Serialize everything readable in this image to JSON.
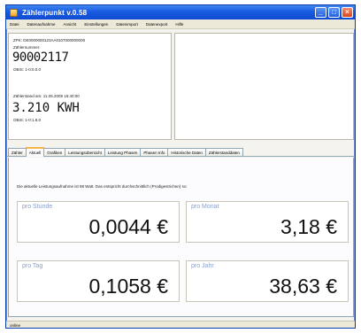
{
  "window": {
    "title": "Zählerpunkt v.0.58",
    "minimize": "_",
    "maximize": "□",
    "close": "×"
  },
  "menu": [
    "Datei",
    "Datenaufnahme",
    "Ansicht",
    "Einstellungen",
    "Datenimport",
    "Datenexport",
    "Hilfe"
  ],
  "meter": {
    "id_line": "ZPK: DE0000000123AA0107000000000",
    "serial_label": "Zählernummer:",
    "serial": "90002117",
    "serial_obis": "OBIS: 1-0:0.0.0",
    "reading_label": "Zählerstand am: 11.05.2009 16:40:00",
    "reading": "3.210 KWH",
    "reading_obis": "OBIS: 1-0:1.8.0"
  },
  "tabs": [
    "Zähler",
    "Aktuell",
    "Grafiken",
    "Leistungsübersicht",
    "Leistung Phasen",
    "Phasen Info",
    "Historische Daten",
    "Zählerstanddaten"
  ],
  "active_tab": 1,
  "content": {
    "info": "Die aktuelle Leistungsaufnahme ist 88 Watt. Das entspricht durchschnittlich (Prodigestrichen) so:",
    "costs": [
      {
        "label": "pro Stunde",
        "value": "0,0044 €"
      },
      {
        "label": "pro Monat",
        "value": "3,18 €"
      },
      {
        "label": "pro Tag",
        "value": "0,1058 €"
      },
      {
        "label": "pro Jahr",
        "value": "38,63 €"
      }
    ]
  },
  "status": "online"
}
